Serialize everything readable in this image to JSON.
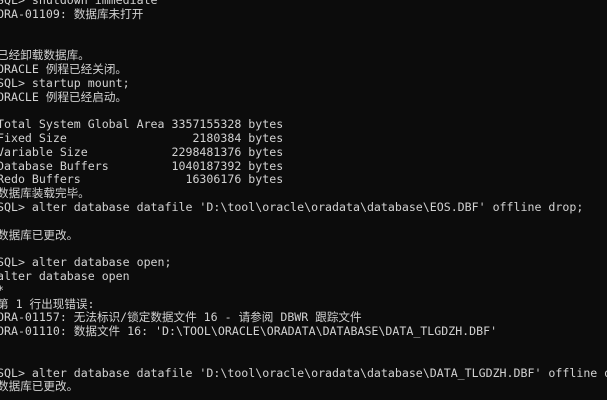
{
  "console": {
    "lines": [
      "SQL> shutdown immediate",
      "ORA-01109: 数据库未打开",
      "",
      "",
      "已经卸载数据库。",
      "ORACLE 例程已经关闭。",
      "SQL> startup mount;",
      "ORACLE 例程已经启动。",
      "",
      "Total System Global Area 3357155328 bytes",
      "Fixed Size                  2180384 bytes",
      "Variable Size            2298481376 bytes",
      "Database Buffers         1040187392 bytes",
      "Redo Buffers               16306176 bytes",
      "数据库装载完毕。",
      "SQL> alter database datafile 'D:\\tool\\oracle\\oradata\\database\\EOS.DBF' offline drop;",
      "",
      "数据库已更改。",
      "",
      "SQL> alter database open;",
      "alter database open",
      "*",
      "第 1 行出现错误:",
      "ORA-01157: 无法标识/锁定数据文件 16 - 请参阅 DBWR 跟踪文件",
      "ORA-01110: 数据文件 16: 'D:\\TOOL\\ORACLE\\ORADATA\\DATABASE\\DATA_TLGDZH.DBF'",
      "",
      "",
      "SQL> alter database datafile 'D:\\tool\\oracle\\oradata\\database\\DATA_TLGDZH.DBF' offline drop;",
      "数据库已更改。"
    ]
  }
}
